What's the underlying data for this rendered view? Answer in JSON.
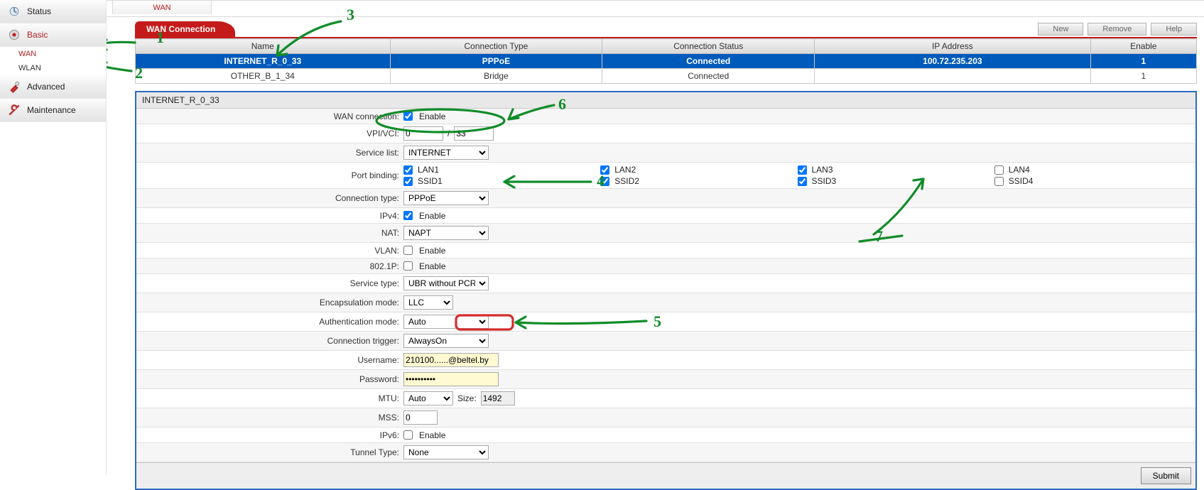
{
  "topstrip": {
    "tab_label": "WAN"
  },
  "sidebar": {
    "items": [
      {
        "label": "Status"
      },
      {
        "label": "Basic",
        "active": true,
        "children": [
          {
            "label": "WAN",
            "active": true
          },
          {
            "label": "WLAN"
          }
        ]
      },
      {
        "label": "Advanced"
      },
      {
        "label": "Maintenance"
      }
    ]
  },
  "header": {
    "section_title": "WAN Connection",
    "buttons": {
      "new": "New",
      "remove": "Remove",
      "help": "Help"
    }
  },
  "table": {
    "columns": [
      "Name",
      "Connection Type",
      "Connection Status",
      "IP Address",
      "Enable"
    ],
    "rows": [
      {
        "name": "INTERNET_R_0_33",
        "ctype": "PPPoE",
        "cstatus": "Connected",
        "ip": "100.72.235.203",
        "enable": "1"
      },
      {
        "name": "OTHER_B_1_34",
        "ctype": "Bridge",
        "cstatus": "Connected",
        "ip": "",
        "enable": "1"
      }
    ]
  },
  "panel": {
    "title": "INTERNET_R_0_33",
    "wan_connection_label": "WAN connection:",
    "enable_label": "Enable",
    "vpi_vci_label": "VPI/VCI:",
    "vpi": "0",
    "vci": "33",
    "vpi_vci_sep": "/",
    "service_list_label": "Service list:",
    "service_list": "INTERNET",
    "port_binding_label": "Port binding:",
    "port_bindings": [
      {
        "label": "LAN1",
        "checked": true
      },
      {
        "label": "LAN2",
        "checked": true
      },
      {
        "label": "LAN3",
        "checked": true
      },
      {
        "label": "LAN4",
        "checked": false
      },
      {
        "label": "SSID1",
        "checked": true
      },
      {
        "label": "SSID2",
        "checked": true
      },
      {
        "label": "SSID3",
        "checked": true
      },
      {
        "label": "SSID4",
        "checked": false
      }
    ],
    "connection_type_label": "Connection type:",
    "connection_type": "PPPoE",
    "ipv4_label": "IPv4:",
    "ipv4_enable_label": "Enable",
    "nat_label": "NAT:",
    "nat": "NAPT",
    "vlan_label": "VLAN:",
    "vlan_enable_label": "Enable",
    "8021p_label": "802.1P:",
    "8021p_enable_label": "Enable",
    "service_type_label": "Service type:",
    "service_type": "UBR without PCR",
    "encap_label": "Encapsulation mode:",
    "encap": "LLC",
    "auth_label": "Authentication mode:",
    "auth": "Auto",
    "trigger_label": "Connection trigger:",
    "trigger": "AlwaysOn",
    "username_label": "Username:",
    "username": "210100......@beltel.by",
    "password_label": "Password:",
    "password": "••••••••••",
    "mtu_label": "MTU:",
    "mtu_mode": "Auto",
    "mtu_size_label": "Size:",
    "mtu_size": "1492",
    "mss_label": "MSS:",
    "mss": "0",
    "ipv6_label": "IPv6:",
    "ipv6_enable_label": "Enable",
    "tunnel_label": "Tunnel Type:",
    "tunnel": "None",
    "submit_label": "Submit"
  },
  "annotations": {
    "n1": "1",
    "n2": "2",
    "n3": "3",
    "n4": "4",
    "n5": "5",
    "n6": "6",
    "n7": "7"
  }
}
